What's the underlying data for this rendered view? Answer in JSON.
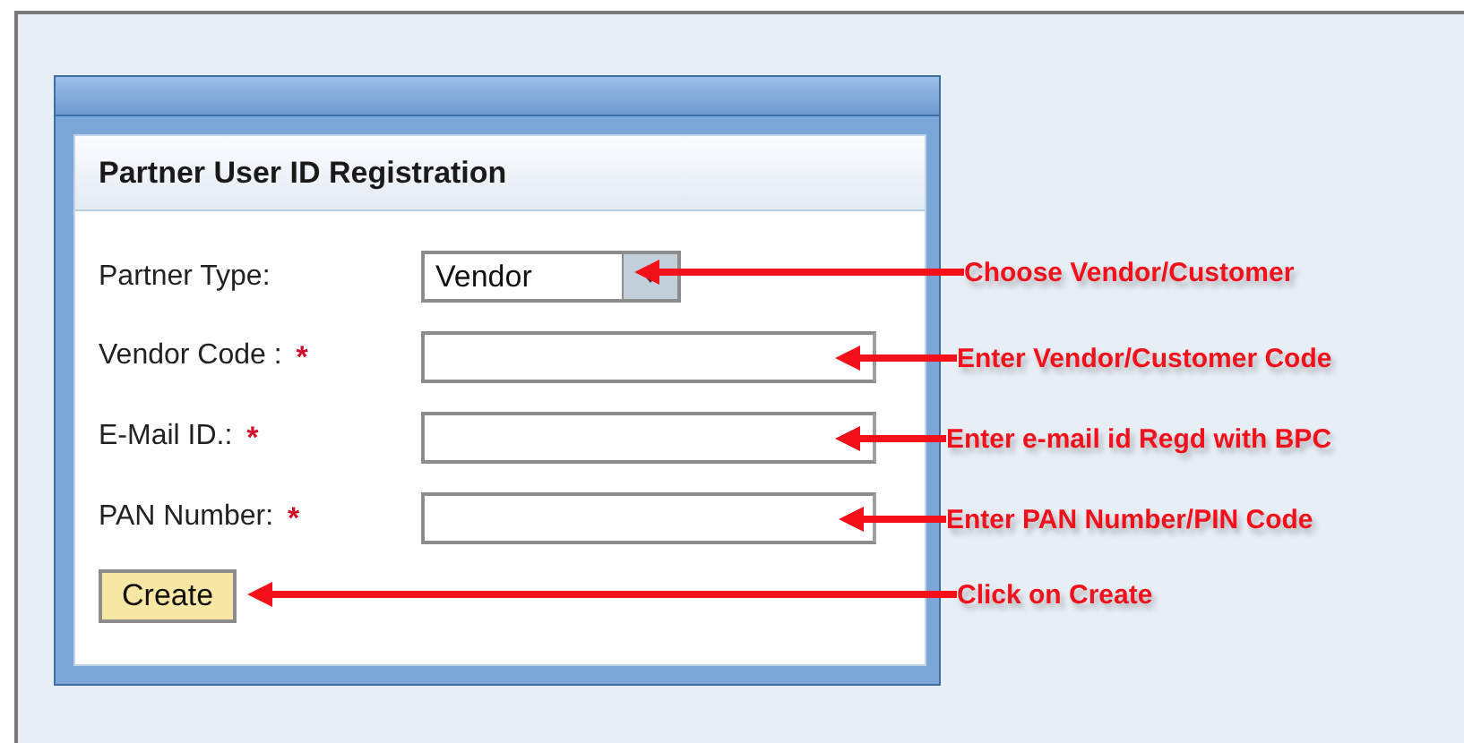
{
  "panel": {
    "title": "Partner User ID Registration"
  },
  "fields": [
    {
      "kind": "select",
      "label": "Partner Type:",
      "required": false,
      "value": "Vendor"
    },
    {
      "kind": "text",
      "label": "Vendor Code :",
      "required": true
    },
    {
      "kind": "text",
      "label": "E-Mail ID.:",
      "required": true
    },
    {
      "kind": "text",
      "label": "PAN Number:",
      "required": true
    }
  ],
  "required_mark": "*",
  "button": "Create",
  "annotations": [
    "Choose Vendor/Customer",
    "Enter Vendor/Customer Code",
    "Enter e-mail id Regd with BPC",
    "Enter PAN Number/PIN Code",
    "Click on Create"
  ]
}
